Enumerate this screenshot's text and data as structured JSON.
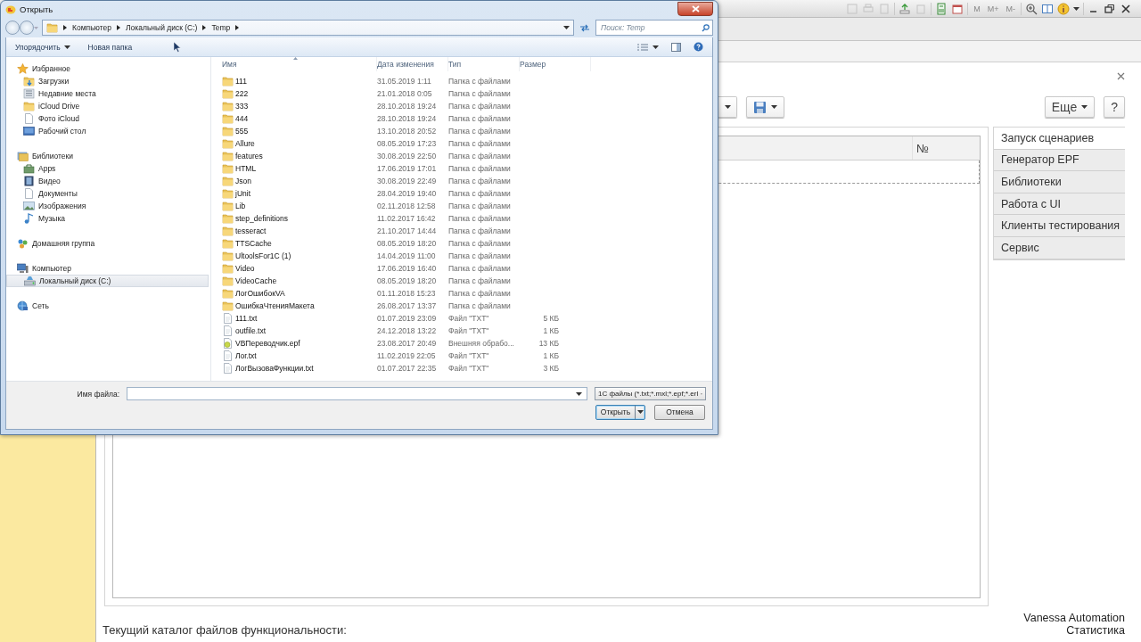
{
  "app": {
    "memory_buttons": [
      "M",
      "M+",
      "M-"
    ],
    "toolbar": {
      "more": "Еще",
      "help": "?"
    },
    "table": {
      "number_column": "№"
    },
    "tabs": [
      {
        "label": "Запуск сценариев",
        "selected": true
      },
      {
        "label": "Генератор EPF",
        "selected": false
      },
      {
        "label": "Библиотеки",
        "selected": false
      },
      {
        "label": "Работа с UI",
        "selected": false
      },
      {
        "label": "Клиенты тестирования",
        "selected": false
      },
      {
        "label": "Сервис",
        "selected": false
      }
    ],
    "footer_label": "Текущий каталог файлов функциональности:",
    "brand": "Vanessa Automation",
    "stats_link": "Статистика"
  },
  "dialog": {
    "title": "Открыть",
    "path": [
      "Компьютер",
      "Локальный диск (C:)",
      "Temp"
    ],
    "search": {
      "placeholder": "Поиск: Temp"
    },
    "toolbar": {
      "organize": "Упорядочить",
      "new_folder": "Новая папка"
    },
    "nav": [
      {
        "label": "Избранное",
        "kind": "favorites",
        "selected": false,
        "children": [
          {
            "label": "Загрузки",
            "kind": "downloads",
            "selected": false
          },
          {
            "label": "Недавние места",
            "kind": "recent",
            "selected": false
          },
          {
            "label": "iCloud Drive",
            "kind": "folder",
            "selected": false
          },
          {
            "label": "Фото iCloud",
            "kind": "file",
            "selected": false
          },
          {
            "label": "Рабочий стол",
            "kind": "desktop",
            "selected": false
          }
        ]
      },
      {
        "label": "Библиотеки",
        "kind": "libraries",
        "selected": false,
        "children": [
          {
            "label": "Apps",
            "kind": "apps",
            "selected": false
          },
          {
            "label": "Видео",
            "kind": "video",
            "selected": false
          },
          {
            "label": "Документы",
            "kind": "file",
            "selected": false
          },
          {
            "label": "Изображения",
            "kind": "images",
            "selected": false
          },
          {
            "label": "Музыка",
            "kind": "music",
            "selected": false
          }
        ]
      },
      {
        "label": "Домашняя группа",
        "kind": "homegroup",
        "selected": false
      },
      {
        "label": "Компьютер",
        "kind": "computer",
        "selected": false,
        "children": [
          {
            "label": "Локальный диск (C:)",
            "kind": "drive",
            "selected": true
          }
        ]
      },
      {
        "label": "Сеть",
        "kind": "network",
        "selected": false
      }
    ],
    "columns": [
      "Имя",
      "Дата изменения",
      "Тип",
      "Размер"
    ],
    "files": [
      {
        "name": "111",
        "modified": "31.05.2019 1:11",
        "type": "Папка с файлами",
        "kind": "folder"
      },
      {
        "name": "222",
        "modified": "21.01.2018 0:05",
        "type": "Папка с файлами",
        "kind": "folder"
      },
      {
        "name": "333",
        "modified": "28.10.2018 19:24",
        "type": "Папка с файлами",
        "kind": "folder"
      },
      {
        "name": "444",
        "modified": "28.10.2018 19:24",
        "type": "Папка с файлами",
        "kind": "folder"
      },
      {
        "name": "555",
        "modified": "13.10.2018 20:52",
        "type": "Папка с файлами",
        "kind": "folder"
      },
      {
        "name": "Allure",
        "modified": "08.05.2019 17:23",
        "type": "Папка с файлами",
        "kind": "folder"
      },
      {
        "name": "features",
        "modified": "30.08.2019 22:50",
        "type": "Папка с файлами",
        "kind": "folder"
      },
      {
        "name": "HTML",
        "modified": "17.06.2019 17:01",
        "type": "Папка с файлами",
        "kind": "folder"
      },
      {
        "name": "Json",
        "modified": "30.08.2019 22:49",
        "type": "Папка с файлами",
        "kind": "folder"
      },
      {
        "name": "jUnit",
        "modified": "28.04.2019 19:40",
        "type": "Папка с файлами",
        "kind": "folder"
      },
      {
        "name": "Lib",
        "modified": "02.11.2018 12:58",
        "type": "Папка с файлами",
        "kind": "folder"
      },
      {
        "name": "step_definitions",
        "modified": "11.02.2017 16:42",
        "type": "Папка с файлами",
        "kind": "folder"
      },
      {
        "name": "tesseract",
        "modified": "21.10.2017 14:44",
        "type": "Папка с файлами",
        "kind": "folder"
      },
      {
        "name": "TTSCache",
        "modified": "08.05.2019 18:20",
        "type": "Папка с файлами",
        "kind": "folder"
      },
      {
        "name": "UltoolsFor1C (1)",
        "modified": "14.04.2019 11:00",
        "type": "Папка с файлами",
        "kind": "folder"
      },
      {
        "name": "Video",
        "modified": "17.06.2019 16:40",
        "type": "Папка с файлами",
        "kind": "folder"
      },
      {
        "name": "VideoCache",
        "modified": "08.05.2019 18:20",
        "type": "Папка с файлами",
        "kind": "folder"
      },
      {
        "name": "ЛогОшибокVA",
        "modified": "01.11.2018 15:23",
        "type": "Папка с файлами",
        "kind": "folder"
      },
      {
        "name": "ОшибкаЧтенияМакета",
        "modified": "26.08.2017 13:37",
        "type": "Папка с файлами",
        "kind": "folder"
      },
      {
        "name": "111.txt",
        "modified": "01.07.2019 23:09",
        "type": "Файл \"TXT\"",
        "size": "5 КБ",
        "kind": "text"
      },
      {
        "name": "outfile.txt",
        "modified": "24.12.2018 13:22",
        "type": "Файл \"TXT\"",
        "size": "1 КБ",
        "kind": "text"
      },
      {
        "name": "VBПереводчик.epf",
        "modified": "23.08.2017 20:49",
        "type": "Внешняя обрабо...",
        "size": "13 КБ",
        "kind": "epf"
      },
      {
        "name": "Лог.txt",
        "modified": "11.02.2019 22:05",
        "type": "Файл \"TXT\"",
        "size": "1 КБ",
        "kind": "text"
      },
      {
        "name": "ЛогВызоваФункции.txt",
        "modified": "01.07.2017 22:35",
        "type": "Файл \"TXT\"",
        "size": "3 КБ",
        "kind": "text"
      }
    ],
    "filename": {
      "label": "Имя файла:"
    },
    "filter": "1С файлы (*.txt;*.mxl;*.epf;*.erl",
    "buttons": [
      {
        "label": "Открыть",
        "kind": "split",
        "focused": true
      },
      {
        "label": "Отмена",
        "kind": "plain",
        "focused": false
      }
    ]
  }
}
